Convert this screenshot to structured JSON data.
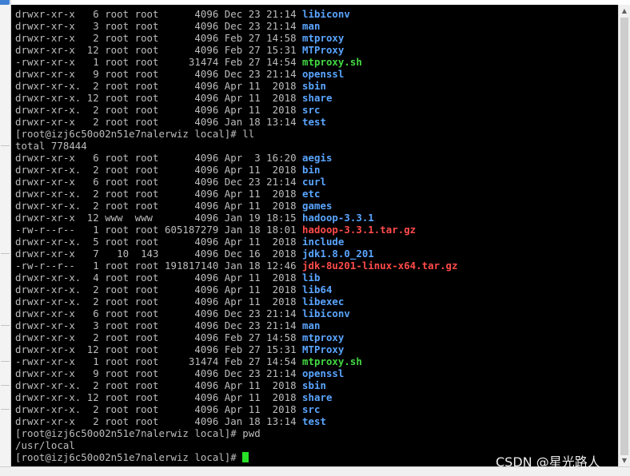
{
  "terminal": {
    "lines": [
      {
        "text": "drwxr-xr-x   6 root root      4096 Dec 23 21:14 ",
        "name": "libiconv",
        "kind": "dir"
      },
      {
        "text": "drwxr-xr-x   3 root root      4096 Dec 23 21:14 ",
        "name": "man",
        "kind": "dir"
      },
      {
        "text": "drwxr-xr-x   2 root root      4096 Feb 27 14:58 ",
        "name": "mtproxy",
        "kind": "dir"
      },
      {
        "text": "drwxr-xr-x  12 root root      4096 Feb 27 15:31 ",
        "name": "MTProxy",
        "kind": "dir"
      },
      {
        "text": "-rwxr-xr-x   1 root root     31474 Feb 27 14:54 ",
        "name": "mtproxy.sh",
        "kind": "exec"
      },
      {
        "text": "drwxr-xr-x   9 root root      4096 Dec 23 21:14 ",
        "name": "openssl",
        "kind": "dir"
      },
      {
        "text": "drwxr-xr-x.  2 root root      4096 Apr 11  2018 ",
        "name": "sbin",
        "kind": "dir"
      },
      {
        "text": "drwxr-xr-x. 12 root root      4096 Apr 11  2018 ",
        "name": "share",
        "kind": "dir"
      },
      {
        "text": "drwxr-xr-x.  2 root root      4096 Apr 11  2018 ",
        "name": "src",
        "kind": "dir"
      },
      {
        "text": "drwxr-xr-x   2 root root      4096 Jan 18 13:14 ",
        "name": "test",
        "kind": "dir"
      },
      {
        "text": "[root@izj6c50o02n51e7nalerwiz local]# ll",
        "name": "",
        "kind": "plain"
      },
      {
        "text": "total 778444",
        "name": "",
        "kind": "plain"
      },
      {
        "text": "drwxr-xr-x   6 root root      4096 Apr  3 16:20 ",
        "name": "aegis",
        "kind": "dir"
      },
      {
        "text": "drwxr-xr-x.  2 root root      4096 Apr 11  2018 ",
        "name": "bin",
        "kind": "dir"
      },
      {
        "text": "drwxr-xr-x   6 root root      4096 Dec 23 21:14 ",
        "name": "curl",
        "kind": "dir"
      },
      {
        "text": "drwxr-xr-x.  2 root root      4096 Apr 11  2018 ",
        "name": "etc",
        "kind": "dir"
      },
      {
        "text": "drwxr-xr-x.  2 root root      4096 Apr 11  2018 ",
        "name": "games",
        "kind": "dir"
      },
      {
        "text": "drwxr-xr-x  12 www  www       4096 Jan 19 18:15 ",
        "name": "hadoop-3.3.1",
        "kind": "dir"
      },
      {
        "text": "-rw-r--r--   1 root root 605187279 Jan 18 18:01 ",
        "name": "hadoop-3.3.1.tar.gz",
        "kind": "archive"
      },
      {
        "text": "drwxr-xr-x.  5 root root      4096 Apr 11  2018 ",
        "name": "include",
        "kind": "dir"
      },
      {
        "text": "drwxr-xr-x   7   10  143      4096 Dec 16  2018 ",
        "name": "jdk1.8.0_201",
        "kind": "dir"
      },
      {
        "text": "-rw-r--r--   1 root root 191817140 Jan 18 12:46 ",
        "name": "jdk-8u201-linux-x64.tar.gz",
        "kind": "archive"
      },
      {
        "text": "drwxr-xr-x.  4 root root      4096 Apr 11  2018 ",
        "name": "lib",
        "kind": "dir"
      },
      {
        "text": "drwxr-xr-x.  2 root root      4096 Apr 11  2018 ",
        "name": "lib64",
        "kind": "dir"
      },
      {
        "text": "drwxr-xr-x.  2 root root      4096 Apr 11  2018 ",
        "name": "libexec",
        "kind": "dir"
      },
      {
        "text": "drwxr-xr-x   6 root root      4096 Dec 23 21:14 ",
        "name": "libiconv",
        "kind": "dir"
      },
      {
        "text": "drwxr-xr-x   3 root root      4096 Dec 23 21:14 ",
        "name": "man",
        "kind": "dir"
      },
      {
        "text": "drwxr-xr-x   2 root root      4096 Feb 27 14:58 ",
        "name": "mtproxy",
        "kind": "dir"
      },
      {
        "text": "drwxr-xr-x  12 root root      4096 Feb 27 15:31 ",
        "name": "MTProxy",
        "kind": "dir"
      },
      {
        "text": "-rwxr-xr-x   1 root root     31474 Feb 27 14:54 ",
        "name": "mtproxy.sh",
        "kind": "exec"
      },
      {
        "text": "drwxr-xr-x   9 root root      4096 Dec 23 21:14 ",
        "name": "openssl",
        "kind": "dir"
      },
      {
        "text": "drwxr-xr-x.  2 root root      4096 Apr 11  2018 ",
        "name": "sbin",
        "kind": "dir"
      },
      {
        "text": "drwxr-xr-x. 12 root root      4096 Apr 11  2018 ",
        "name": "share",
        "kind": "dir"
      },
      {
        "text": "drwxr-xr-x.  2 root root      4096 Apr 11  2018 ",
        "name": "src",
        "kind": "dir"
      },
      {
        "text": "drwxr-xr-x   2 root root      4096 Jan 18 13:14 ",
        "name": "test",
        "kind": "dir"
      },
      {
        "text": "[root@izj6c50o02n51e7nalerwiz local]# pwd",
        "name": "",
        "kind": "plain"
      },
      {
        "text": "/usr/local",
        "name": "",
        "kind": "plain"
      },
      {
        "text": "[root@izj6c50o02n51e7nalerwiz local]# ",
        "name": "",
        "kind": "prompt"
      }
    ]
  },
  "watermark": "CSDN @星光路人",
  "icons": {
    "scroll_up": "scroll-up-arrow-icon",
    "scroll_down": "scroll-down-arrow-icon"
  },
  "colors": {
    "background": "#000000",
    "text": "#bdbdbd",
    "directory": "#5aa5ff",
    "executable": "#43d943",
    "archive": "#ff4a4a",
    "cursor": "#28e028"
  }
}
